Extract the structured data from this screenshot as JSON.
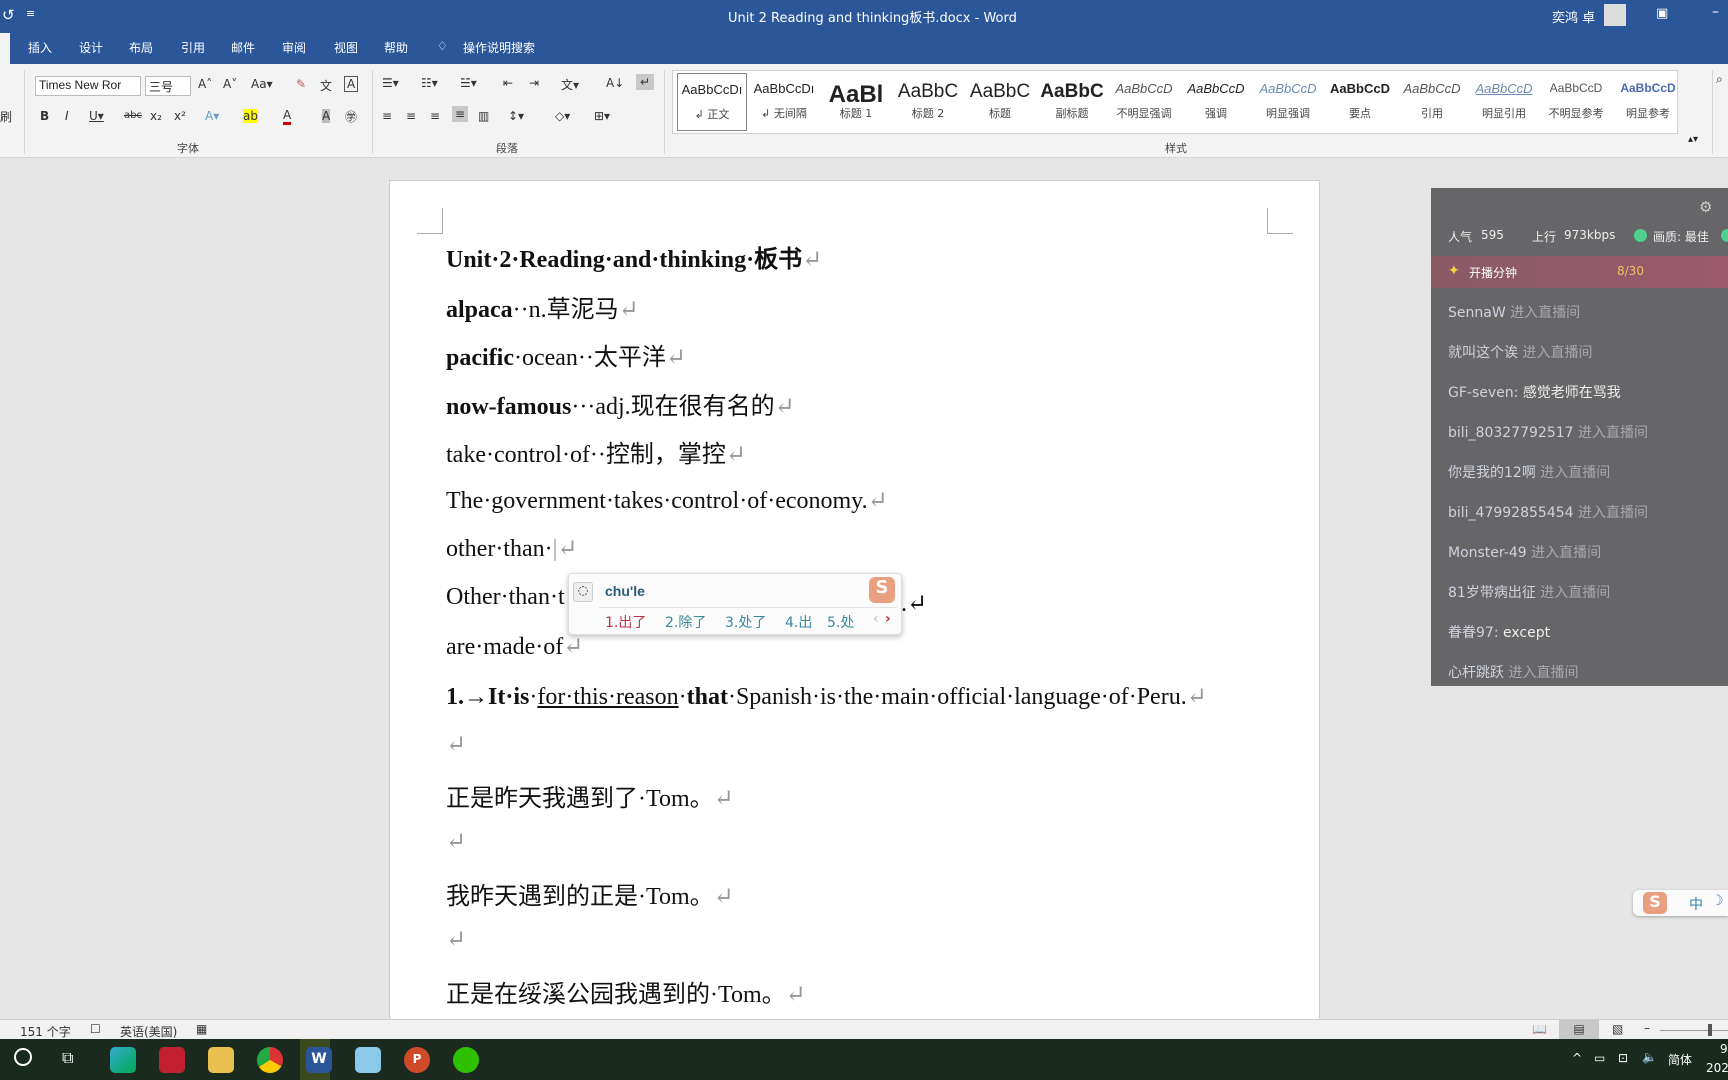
{
  "title": {
    "doc": "Unit 2 Reading and thinking板书.docx  -  Word",
    "user": "奕鸿 卓"
  },
  "tabs": [
    "插入",
    "设计",
    "布局",
    "引用",
    "邮件",
    "审阅",
    "视图",
    "帮助"
  ],
  "search": "操作说明搜索",
  "font": {
    "name": "Times New Ror",
    "size": "三号",
    "group": "字体"
  },
  "paragraph": {
    "group": "段落"
  },
  "styles": {
    "group": "样式",
    "items": [
      {
        "preview": "AaBbCcDı",
        "label": "↲ 正文"
      },
      {
        "preview": "AaBbCcDı",
        "label": "↲ 无间隔"
      },
      {
        "preview": "AaBl",
        "label": "标题 1"
      },
      {
        "preview": "AaBbC",
        "label": "标题 2"
      },
      {
        "preview": "AaBbC",
        "label": "标题"
      },
      {
        "preview": "AaBbC",
        "label": "副标题"
      },
      {
        "preview": "AaBbCcD",
        "label": "不明显强调"
      },
      {
        "preview": "AaBbCcD",
        "label": "强调"
      },
      {
        "preview": "AaBbCcD",
        "label": "明显强调"
      },
      {
        "preview": "AaBbCcD",
        "label": "要点"
      },
      {
        "preview": "AaBbCcD",
        "label": "引用"
      },
      {
        "preview": "AaBbCcD",
        "label": "明显引用"
      },
      {
        "preview": "AaBbCcD",
        "label": "不明显参考"
      },
      {
        "preview": "AaBbCcD",
        "label": "明显参考"
      }
    ]
  },
  "doc": {
    "lines": [
      [
        {
          "t": "Unit·2·Reading·and·thinking·板书",
          "b": 1
        },
        {
          "t": "↵",
          "p": 1
        }
      ],
      [
        {
          "t": "alpaca",
          "b": 1
        },
        {
          "t": "··n.草泥马"
        },
        {
          "t": "↵",
          "p": 1
        }
      ],
      [
        {
          "t": "pacific",
          "b": 1
        },
        {
          "t": "·ocean··太平洋"
        },
        {
          "t": "↵",
          "p": 1
        }
      ],
      [
        {
          "t": "now-famous",
          "b": 1
        },
        {
          "t": "···adj.现在很有名的"
        },
        {
          "t": "↵",
          "p": 1
        }
      ],
      [
        {
          "t": "take·control·of··控制，掌控"
        },
        {
          "t": "↵",
          "p": 1
        }
      ],
      [
        {
          "t": "The·government·takes·control·of·economy."
        },
        {
          "t": "↵",
          "p": 1
        }
      ],
      [
        {
          "t": "other·than·"
        },
        {
          "t": "|↵",
          "p": 1
        }
      ],
      [
        {
          "t": "Other·than·t"
        }
      ],
      [
        {
          "t": "are·made·of"
        },
        {
          "t": "↵",
          "p": 1
        }
      ],
      [
        {
          "t": "1.→It·is",
          "b": 1
        },
        {
          "t": "·"
        },
        {
          "t": "for·this·reason",
          "u": 1
        },
        {
          "t": "·"
        },
        {
          "t": "that",
          "b": 1
        },
        {
          "t": "·Spanish·is·the·main·official·language·of·Peru."
        },
        {
          "t": "↵",
          "p": 1
        }
      ],
      [
        {
          "t": "↵",
          "p": 1
        }
      ],
      [
        {
          "t": "正是昨天我遇到了·Tom。"
        },
        {
          "t": "↵",
          "p": 1
        }
      ],
      [
        {
          "t": "↵",
          "p": 1
        }
      ],
      [
        {
          "t": "我昨天遇到的正是·Tom。"
        },
        {
          "t": "↵",
          "p": 1
        }
      ],
      [
        {
          "t": "↵",
          "p": 1
        }
      ],
      [
        {
          "t": "正是在绥溪公园我遇到的·Tom。"
        },
        {
          "t": "↵",
          "p": 1
        }
      ]
    ],
    "hidden_tail": ".↵"
  },
  "ime": {
    "input": "chu'le",
    "candidates": [
      "1.出了",
      "2.除了",
      "3.处了",
      "4.出",
      "5.处"
    ]
  },
  "chat": {
    "popularity_label": "人气",
    "popularity": "595",
    "upload_label": "上行",
    "upload": "973kbps",
    "quality": "画质: 最佳",
    "task": "开播分钟",
    "task_progress": "8/30",
    "messages": [
      {
        "u": "SennaW",
        "m": "进入直播间",
        "sys": 1
      },
      {
        "u": "就叫这个诶",
        "m": "进入直播间",
        "sys": 1
      },
      {
        "u": "GF-seven:",
        "m": "感觉老师在骂我"
      },
      {
        "u": "bili_80327792517",
        "m": "进入直播间",
        "sys": 1
      },
      {
        "u": "你是我的12啊",
        "m": "进入直播间",
        "sys": 1
      },
      {
        "u": "bili_47992855454",
        "m": "进入直播间",
        "sys": 1
      },
      {
        "u": "Monster-49",
        "m": "进入直播间",
        "sys": 1
      },
      {
        "u": "81岁带病出征",
        "m": "进入直播间",
        "sys": 1
      },
      {
        "u": "眷眷97:",
        "m": "except"
      },
      {
        "u": "心杆跳跃",
        "m": "进入直播间",
        "sys": 1
      }
    ]
  },
  "statusbar": {
    "words": "151 个字",
    "lang": "英语(美国)"
  },
  "tray": {
    "ime": "简体",
    "time": "9",
    "date": "202"
  },
  "sogou": {
    "mode": "中"
  }
}
